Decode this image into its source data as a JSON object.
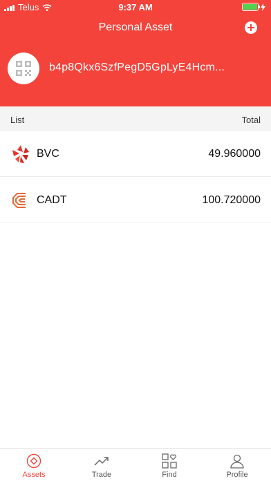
{
  "status_bar": {
    "carrier": "Telus",
    "time": "9:37 AM"
  },
  "header": {
    "title": "Personal Asset",
    "address": "b4p8Qkx6SzfPegD5GpLyE4Hcm..."
  },
  "list": {
    "header_left": "List",
    "header_right": "Total",
    "items": [
      {
        "name": "BVC",
        "amount": "49.960000",
        "icon": "bvc-logo-icon"
      },
      {
        "name": "CADT",
        "amount": "100.720000",
        "icon": "cadt-logo-icon"
      }
    ]
  },
  "tabs": [
    {
      "label": "Assets",
      "icon": "assets-icon",
      "active": true
    },
    {
      "label": "Trade",
      "icon": "trend-icon",
      "active": false
    },
    {
      "label": "Find",
      "icon": "grid-heart-icon",
      "active": false
    },
    {
      "label": "Profile",
      "icon": "person-icon",
      "active": false
    }
  ],
  "colors": {
    "brand": "#f4433b",
    "battery": "#52d34f",
    "list_header_bg": "#f4f4f4"
  }
}
